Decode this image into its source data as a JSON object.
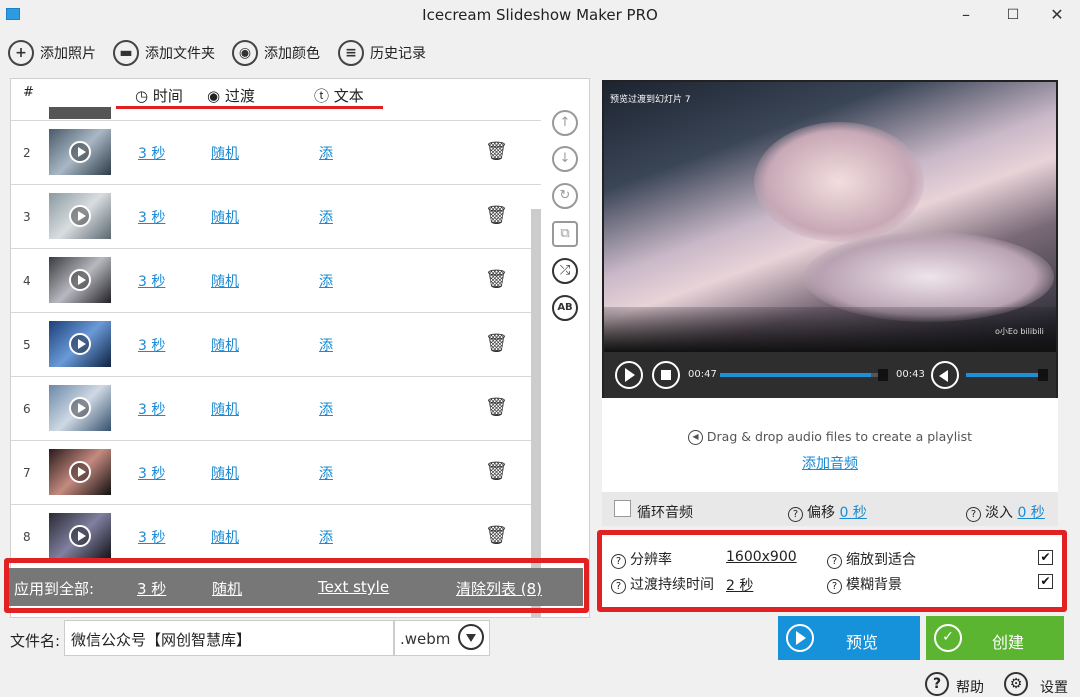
{
  "window": {
    "title": "Icecream Slideshow Maker PRO",
    "minimize": "–",
    "maximize": "☐",
    "close": "✕"
  },
  "toolbar": {
    "add_photo": "添加照片",
    "add_folder": "添加文件夹",
    "add_color": "添加颜色",
    "history": "历史记录"
  },
  "list": {
    "headers": {
      "num": "#",
      "time": "时间",
      "transition": "过渡",
      "text": "文本"
    },
    "rows": [
      {
        "num": "2",
        "time": "3 秒",
        "transition": "随机",
        "text": "添"
      },
      {
        "num": "3",
        "time": "3 秒",
        "transition": "随机",
        "text": "添"
      },
      {
        "num": "4",
        "time": "3 秒",
        "transition": "随机",
        "text": "添"
      },
      {
        "num": "5",
        "time": "3 秒",
        "transition": "随机",
        "text": "添"
      },
      {
        "num": "6",
        "time": "3 秒",
        "transition": "随机",
        "text": "添"
      },
      {
        "num": "7",
        "time": "3 秒",
        "transition": "随机",
        "text": "添"
      },
      {
        "num": "8",
        "time": "3 秒",
        "transition": "随机",
        "text": "添"
      }
    ]
  },
  "apply_all": {
    "label": "应用到全部:",
    "time": "3 秒",
    "transition": "随机",
    "text_style": "Text style",
    "clear_list": "清除列表 (8)"
  },
  "filename": {
    "label": "文件名:",
    "value": "微信公众号【网创智慧库】",
    "extension": ".webm"
  },
  "preview": {
    "caption": "预览过渡到幻灯片 7",
    "watermark": "o小Eo  bilibili",
    "time_current": "00:47",
    "time_total": "00:43",
    "progress": 0.9,
    "volume": 0.9
  },
  "audio": {
    "drag_text": "Drag & drop audio files to create a playlist",
    "add_audio": "添加音频",
    "loop_label": "循环音频",
    "loop_checked": false,
    "offset_label": "偏移",
    "offset_value": "0 秒",
    "fade_label": "淡入",
    "fade_value": "0 秒"
  },
  "settings": {
    "resolution_label": "分辨率",
    "resolution_value": "1600x900",
    "fit_label": "缩放到适合",
    "fit_checked": true,
    "transition_duration_label": "过渡持续时间",
    "transition_duration_value": "2 秒",
    "blur_label": "模糊背景",
    "blur_checked": true
  },
  "buttons": {
    "preview": "预览",
    "create": "创建",
    "help": "帮助",
    "settings": "设置"
  },
  "colors": {
    "accent_blue": "#1592d9",
    "create_green": "#5cb531",
    "highlight_red": "#e22222",
    "link": "#1a8ad4"
  }
}
